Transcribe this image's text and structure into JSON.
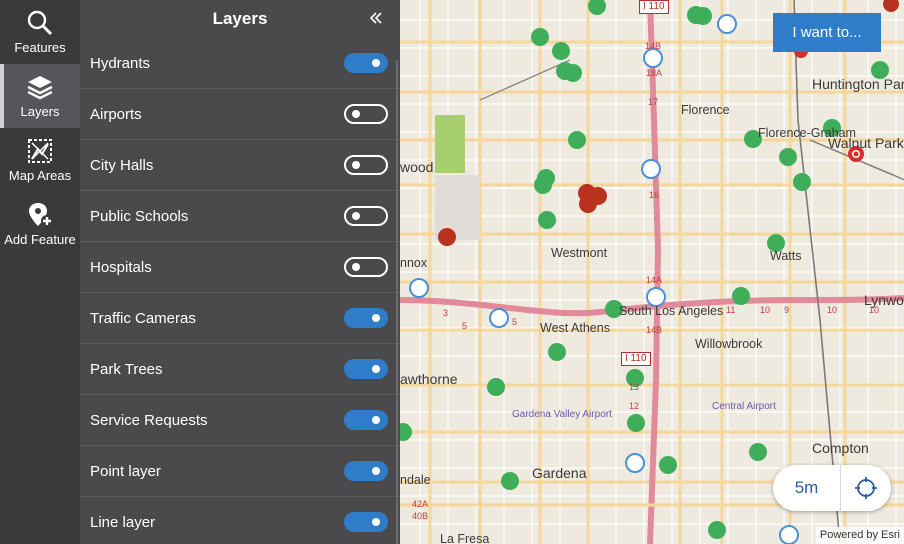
{
  "nav": {
    "items": [
      {
        "label": "Features",
        "icon": "search-icon"
      },
      {
        "label": "Layers",
        "icon": "layers-icon",
        "active": true
      },
      {
        "label": "Map Areas",
        "icon": "map-areas-icon"
      },
      {
        "label": "Add Feature",
        "icon": "add-feature-icon"
      }
    ]
  },
  "layers_panel": {
    "title": "Layers",
    "collapse_icon": "double-chevron-left-icon",
    "layers": [
      {
        "label": "Hydrants",
        "on": true
      },
      {
        "label": "Airports",
        "on": false
      },
      {
        "label": "City Halls",
        "on": false
      },
      {
        "label": "Public Schools",
        "on": false
      },
      {
        "label": "Hospitals",
        "on": false
      },
      {
        "label": "Traffic Cameras",
        "on": true
      },
      {
        "label": "Park Trees",
        "on": true
      },
      {
        "label": "Service Requests",
        "on": true
      },
      {
        "label": "Point layer",
        "on": true
      },
      {
        "label": "Line layer",
        "on": true
      }
    ]
  },
  "map": {
    "want_button": "I want to...",
    "scale_label": "5m",
    "locate_icon": "crosshair-locate-icon",
    "attribution": "Powered by Esri",
    "places": {
      "huntington_park": "Huntington Park",
      "florence": "Florence",
      "florence_graham": "Florence-Graham",
      "walnut_park": "Walnut Park",
      "wood": "wood",
      "westmont": "Westmont",
      "watts": "Watts",
      "lynwood": "Lynwo",
      "nnox": "nnox",
      "south_la": "South Los Angeles",
      "west_athens": "West Athens",
      "willowbrook": "Willowbrook",
      "hawthorne": "awthorne",
      "gardena_airport": "Gardena Valley Airport",
      "central_airport": "Central Airport",
      "compton": "Compton",
      "gardena": "Gardena",
      "ndale": "ndale",
      "la_fresa": "La Fresa"
    },
    "shields": {
      "i110_top": "I 110",
      "i110_mid": "I 110"
    },
    "exit_numbers": [
      "14B",
      "18A",
      "17",
      "16",
      "14A",
      "14B",
      "13",
      "12",
      "11",
      "10",
      "9",
      "10",
      "10",
      "5",
      "5",
      "3",
      "42A",
      "40B"
    ]
  },
  "colors": {
    "accent": "#2f7cc8",
    "rail_bg": "#3a3a3c",
    "panel_bg": "#4a4a4d",
    "tree_green": "#3fae5a",
    "hydrant_red": "#b8321f",
    "camera_blue": "#4a90d9"
  }
}
